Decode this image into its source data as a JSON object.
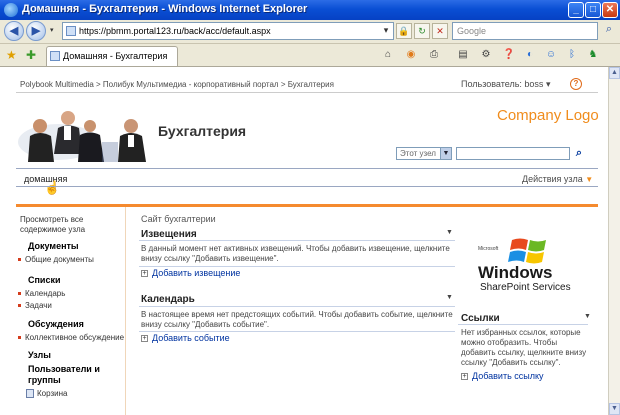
{
  "window": {
    "title": "Домашняя - Бухгалтерия - Windows Internet Explorer",
    "minimize": "_",
    "maximize": "□",
    "close": "✕"
  },
  "browser": {
    "url": "https://pbmm.portal123.ru/back/acc/default.aspx",
    "search_placeholder": "Google",
    "tab_label": "Домашняя - Бухгалтерия",
    "icons": [
      "back-icon",
      "forward-icon",
      "lock-icon",
      "refresh-icon",
      "stop-icon",
      "favorites-star-icon",
      "add-favorites-icon",
      "home-icon",
      "feeds-icon",
      "print-icon",
      "page-icon",
      "tools-icon",
      "help-icon"
    ]
  },
  "page": {
    "breadcrumb": "Polybook Multimedia > Полибук Мультимедиа - корпоративный портал > Бухгалтерия",
    "user_label": "Пользователь: boss",
    "user_arrow": "▾",
    "help_glyph": "?",
    "site_title": "Бухгалтерия",
    "company_logo": "Company Logo",
    "search_scope": "Этот узел",
    "home_tab": "домашняя",
    "site_actions": "Действия узла",
    "quick_launch": {
      "view_all": "Просмотреть все содержимое узла",
      "documents_head": "Документы",
      "documents_items": [
        "Общие документы"
      ],
      "lists_head": "Списки",
      "lists_items": [
        "Календарь",
        "Задачи"
      ],
      "discussions_head": "Обсуждения",
      "discussions_items": [
        "Коллективное обсуждение"
      ],
      "sites_head": "Узлы",
      "people_head": "Пользователи и группы",
      "recycle_bin": "Корзина"
    },
    "main_title": "Сайт бухгалтерии",
    "announcements": {
      "title": "Извещения",
      "text": "В данный момент нет активных извещений. Чтобы добавить извещение, щелкните внизу ссылку \"Добавить извещение\".",
      "add": "Добавить извещение"
    },
    "calendar": {
      "title": "Календарь",
      "text": "В настоящее время нет предстоящих событий. Чтобы добавить событие, щелкните внизу ссылку \"Добавить событие\".",
      "add": "Добавить событие"
    },
    "links": {
      "title": "Ссылки",
      "text": "Нет избранных ссылок, которые можно отобразить. Чтобы добавить ссылку, щелкните внизу ссылку \"Добавить ссылку\".",
      "add": "Добавить ссылку"
    },
    "wss_logo": {
      "line1": "Microsoft",
      "line2": "Windows",
      "line3": "SharePoint Services"
    }
  },
  "colors": {
    "accent_orange": "#f58a2e",
    "link_blue": "#0033a0",
    "titlebar_blue": "#0a4fd4"
  }
}
